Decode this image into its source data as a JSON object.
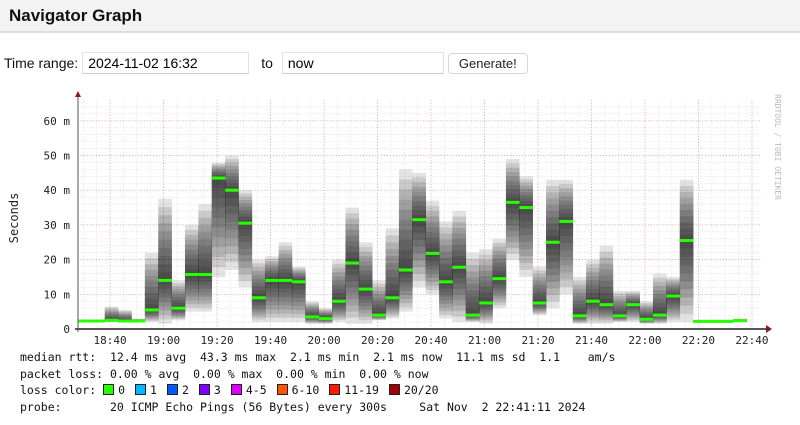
{
  "header": {
    "title": "Navigator Graph"
  },
  "time_range": {
    "label": "Time range:",
    "from_value": "2024-11-02 16:32",
    "to_label": "to",
    "to_value": "now",
    "generate_label": "Generate!"
  },
  "chart_data": {
    "type": "area",
    "title": "",
    "ylabel": "Seconds",
    "side_label": "RRDTOOL / TOBI OETIKER",
    "ylim": [
      0,
      65
    ],
    "yticks": [
      {
        "v": 0,
        "label": "0"
      },
      {
        "v": 10,
        "label": "10 m"
      },
      {
        "v": 20,
        "label": "20 m"
      },
      {
        "v": 30,
        "label": "30 m"
      },
      {
        "v": 40,
        "label": "40 m"
      },
      {
        "v": 50,
        "label": "50 m"
      },
      {
        "v": 60,
        "label": "60 m"
      }
    ],
    "xrange_minutes": [
      1108,
      1363
    ],
    "xticks": [
      {
        "m": 1120,
        "label": "18:40"
      },
      {
        "m": 1140,
        "label": "19:00"
      },
      {
        "m": 1160,
        "label": "19:20"
      },
      {
        "m": 1180,
        "label": "19:40"
      },
      {
        "m": 1200,
        "label": "20:00"
      },
      {
        "m": 1220,
        "label": "20:20"
      },
      {
        "m": 1240,
        "label": "20:40"
      },
      {
        "m": 1260,
        "label": "21:00"
      },
      {
        "m": 1280,
        "label": "21:20"
      },
      {
        "m": 1300,
        "label": "21:40"
      },
      {
        "m": 1320,
        "label": "22:00"
      },
      {
        "m": 1340,
        "label": "22:20"
      },
      {
        "m": 1360,
        "label": "22:40"
      }
    ],
    "bin_start_minutes": 1108,
    "bin_minutes": 5,
    "median_ms": [
      2.3,
      2.3,
      2.5,
      2.3,
      2.3,
      5.5,
      14,
      6,
      15.7,
      15.7,
      43.5,
      40,
      30.5,
      9,
      14,
      14,
      13.6,
      3.5,
      3,
      8,
      19,
      11.5,
      4,
      9,
      17,
      31.5,
      21.8,
      13.6,
      17.8,
      4,
      7.5,
      14.5,
      36.5,
      35,
      7.5,
      25,
      31,
      3.8,
      8,
      7,
      3.8,
      7,
      2.8,
      4,
      9.5,
      25.5,
      2.2,
      2.2,
      2.2,
      2.4
    ],
    "max_ms": [
      2.3,
      2.3,
      6.5,
      5.5,
      3,
      22,
      37.5,
      14,
      30,
      36,
      48,
      50,
      40,
      20,
      21,
      25,
      18,
      8,
      6,
      20,
      35,
      25,
      14,
      29,
      46,
      45,
      37,
      31,
      34,
      22,
      23,
      26,
      49,
      44,
      18,
      43,
      43,
      15,
      20,
      24,
      11,
      11,
      8,
      16,
      15,
      43,
      2.5,
      2.5,
      2.5,
      3
    ],
    "min_ms": [
      2,
      2,
      2,
      2,
      2,
      2,
      1.5,
      2.5,
      5,
      5,
      15,
      17,
      12,
      2,
      2,
      2,
      2,
      1.5,
      1.5,
      2,
      1.5,
      1.5,
      2.5,
      3,
      5,
      12,
      10,
      3,
      2,
      2,
      1.5,
      6,
      20,
      15,
      4,
      6,
      10,
      1.5,
      1.5,
      1.5,
      2,
      2,
      1.5,
      1.5,
      2,
      2,
      2,
      2,
      2,
      2
    ],
    "median_color": "#26ff00"
  },
  "legend": {
    "median_rtt": "median rtt:  12.4 ms avg  43.3 ms max  2.1 ms min  2.1 ms now  11.1 ms sd  1.1    am/s",
    "packet_loss": "packet loss: 0.00 % avg  0.00 % max  0.00 % min  0.00 % now",
    "loss_color_label": "loss color: ",
    "loss_colors": [
      {
        "label": "0",
        "color": "#26ff00"
      },
      {
        "label": "1",
        "color": "#00b8ff"
      },
      {
        "label": "2",
        "color": "#0059ff"
      },
      {
        "label": "3",
        "color": "#7e00ff"
      },
      {
        "label": "4-5",
        "color": "#dd00ff"
      },
      {
        "label": "6-10",
        "color": "#ff5500"
      },
      {
        "label": "11-19",
        "color": "#ff1a00"
      },
      {
        "label": "20/20",
        "color": "#a10000"
      }
    ],
    "probe": "probe:       20 ICMP Echo Pings (56 Bytes) every 300s",
    "date": "Sat Nov  2 22:41:11 2024"
  }
}
